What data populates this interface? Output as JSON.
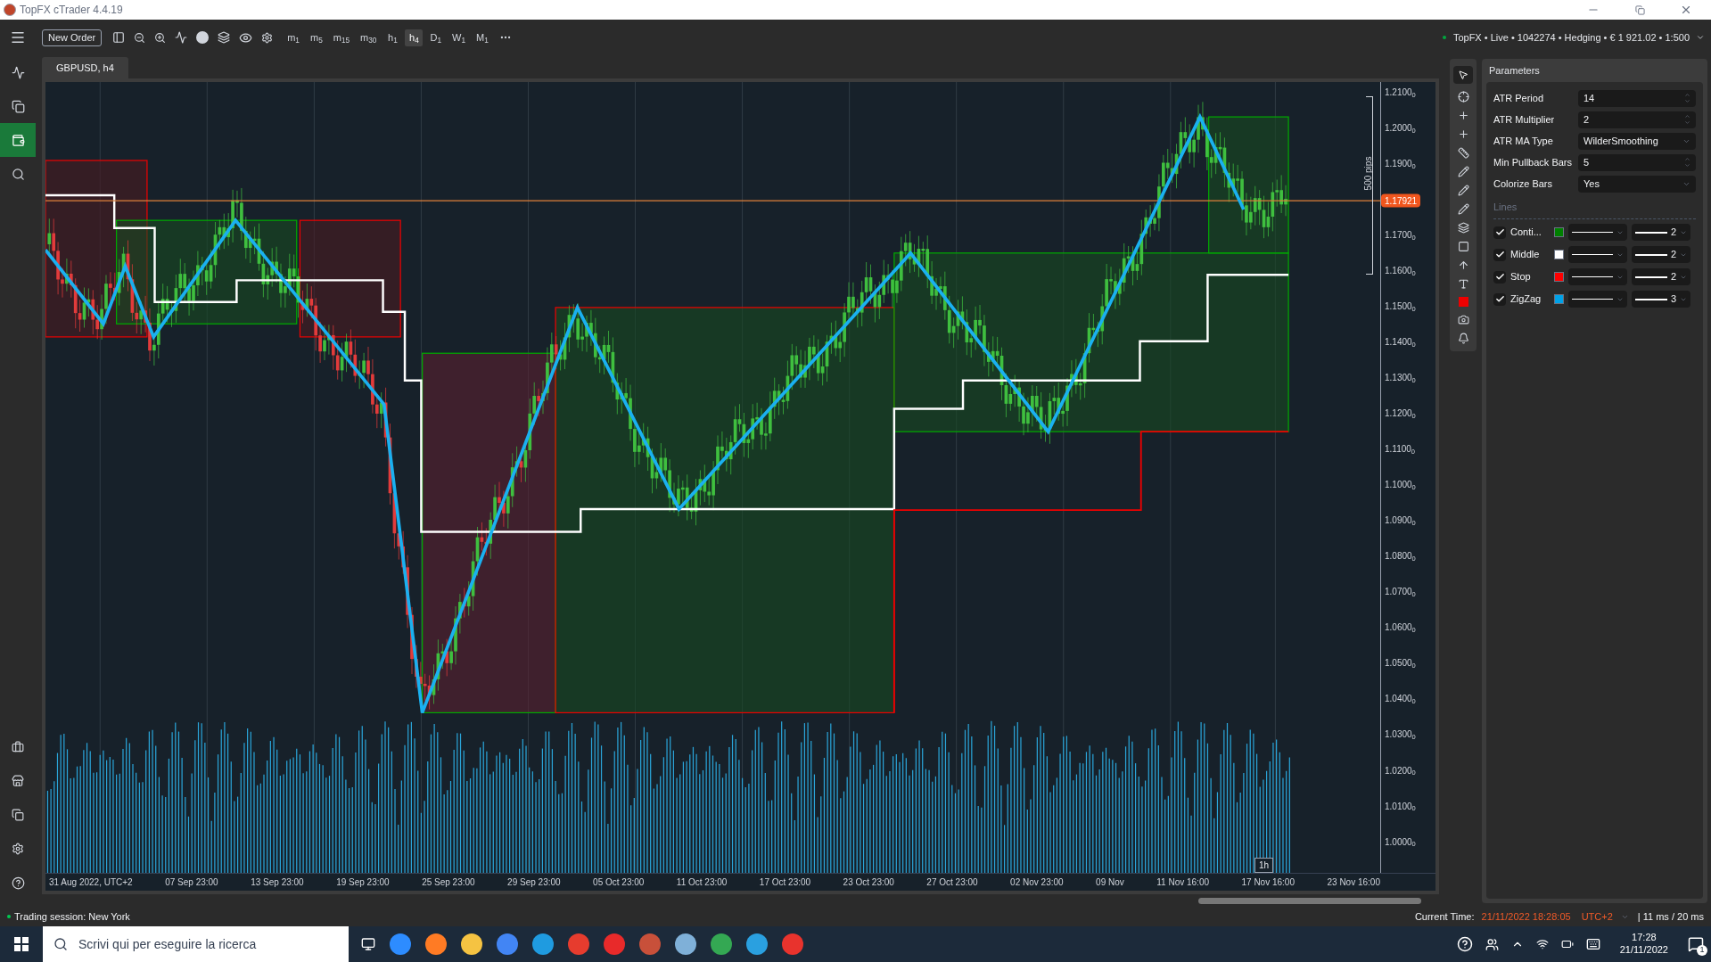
{
  "window": {
    "title": "TopFX cTrader 4.4.19"
  },
  "toolbar": {
    "new_order": "New Order",
    "timeframes": [
      {
        "label": "m$_{1}$",
        "selected": false
      },
      {
        "label": "m$_{5}$",
        "selected": false
      },
      {
        "label": "m$_{15}$",
        "selected": false
      },
      {
        "label": "m$_{30}$",
        "selected": false
      },
      {
        "label": "h$_{1}$",
        "selected": false
      },
      {
        "label": "h$_{4}$",
        "selected": true
      },
      {
        "label": "D$_{1}$",
        "selected": false
      },
      {
        "label": "W$_{1}$",
        "selected": false
      },
      {
        "label": "M$_{1}$",
        "selected": false
      }
    ],
    "account": "TopFX • Live • 1042274 • Hedging • € 1 921.02 • 1:500"
  },
  "sidebar": {
    "items": [
      {
        "selected": false
      },
      {
        "selected": false
      },
      {
        "selected": true
      },
      {
        "selected": false
      }
    ]
  },
  "chart": {
    "tab": "GBPUSD, h4",
    "price_tag": "1.17921",
    "range_label": "500 pips",
    "cursor_label": "1h",
    "y_labels": [
      "1.2100$_{0}$",
      "1.2000$_{0}$",
      "1.1900$_{0}$",
      "1.1700$_{0}$",
      "1.1600$_{0}$",
      "1.1500$_{0}$",
      "1.1400$_{0}$",
      "1.1300$_{0}$",
      "1.1200$_{0}$",
      "1.1100$_{0}$",
      "1.1000$_{0}$",
      "1.0900$_{0}$",
      "1.0800$_{0}$",
      "1.0700$_{0}$",
      "1.0600$_{0}$",
      "1.0500$_{0}$",
      "1.0400$_{0}$",
      "1.0300$_{0}$",
      "1.0200$_{0}$",
      "1.0100$_{0}$",
      "1.0000$_{0}$"
    ],
    "x_labels": [
      "31 Aug 2022, UTC+2",
      "07 Sep 23:00",
      "13 Sep 23:00",
      "19 Sep 23:00",
      "25 Sep 23:00",
      "29 Sep 23:00",
      "05 Oct 23:00",
      "11 Oct 23:00",
      "17 Oct 23:00",
      "23 Oct 23:00",
      "27 Oct 23:00",
      "02 Nov 23:00",
      "09 Nov",
      "11 Nov 16:00",
      "17 Nov 16:00",
      "23 Nov 16:00"
    ]
  },
  "parameters": {
    "title": "Parameters",
    "fields": [
      {
        "label": "ATR Period",
        "value": "14",
        "kind": "spinner"
      },
      {
        "label": "ATR Multiplier",
        "value": "2",
        "kind": "spinner"
      },
      {
        "label": "ATR MA Type",
        "value": "WilderSmoothing",
        "kind": "dropdown"
      },
      {
        "label": "Min Pullback Bars",
        "value": "5",
        "kind": "spinner"
      },
      {
        "label": "Colorize Bars",
        "value": "Yes",
        "kind": "dropdown"
      }
    ],
    "lines_title": "Lines",
    "lines": [
      {
        "name": "Conti...",
        "checked": true,
        "color": "#008000",
        "thickness": "2"
      },
      {
        "name": "Middle",
        "checked": true,
        "color": "#ffffff",
        "thickness": "2"
      },
      {
        "name": "Stop",
        "checked": true,
        "color": "#ff0000",
        "thickness": "2"
      },
      {
        "name": "ZigZag",
        "checked": true,
        "color": "#00a2e8",
        "thickness": "3"
      }
    ]
  },
  "status_bar": {
    "session": "Trading session: New York",
    "time_label": "Current Time:",
    "time": "21/11/2022 18:28:05",
    "timezone": "UTC+2",
    "latency": "| 11 ms / 20 ms"
  },
  "taskbar": {
    "search_placeholder": "Scrivi qui per eseguire la ricerca",
    "clock_time": "17:28",
    "clock_date": "21/11/2022",
    "notification_count": "1"
  }
}
